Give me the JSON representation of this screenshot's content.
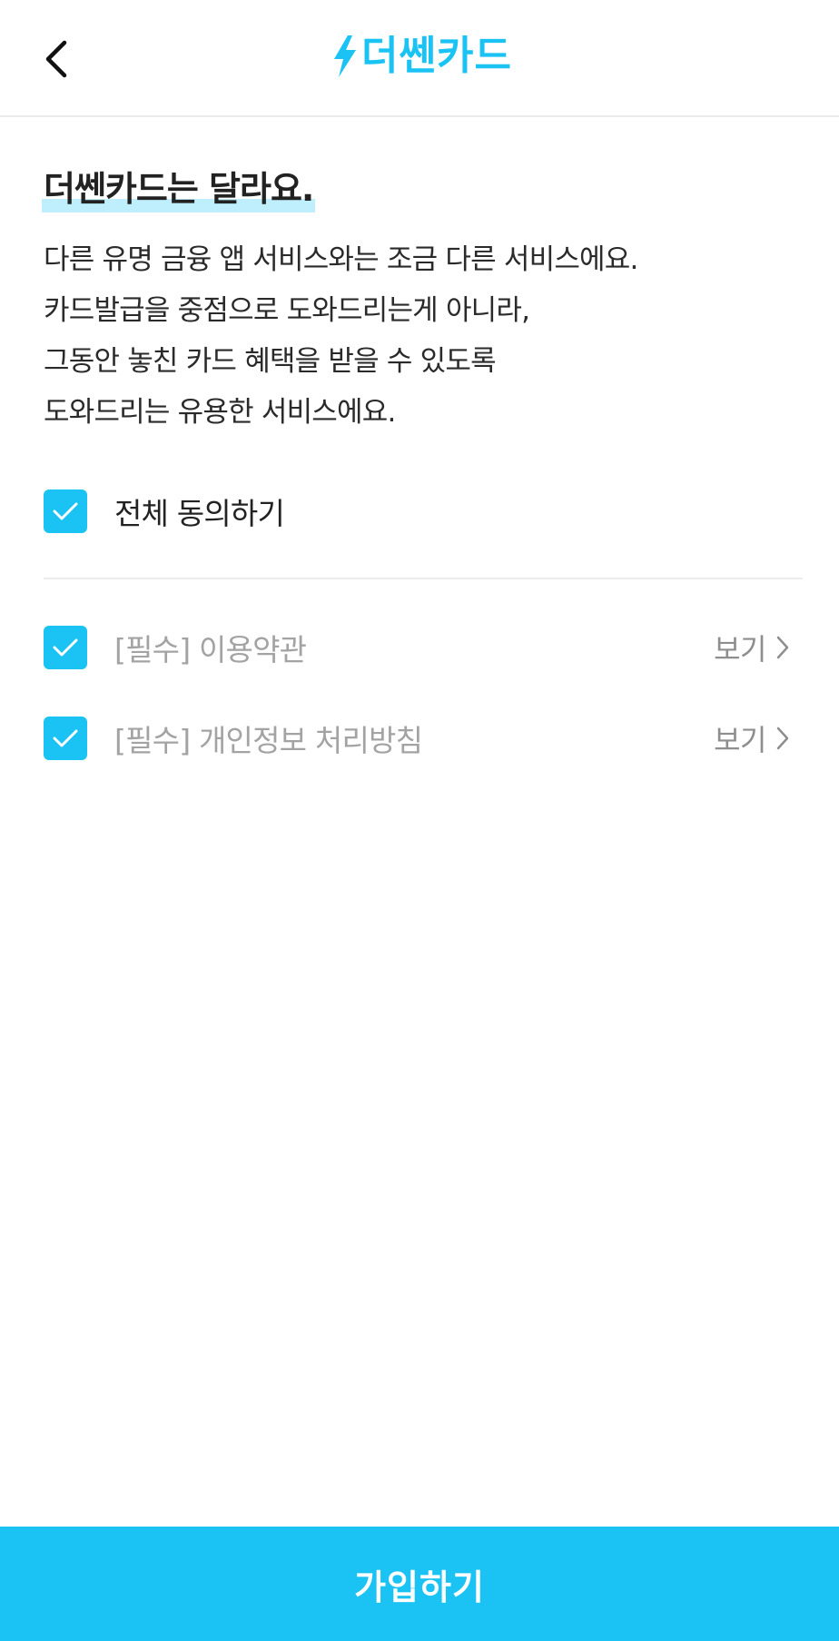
{
  "header": {
    "back_icon": "chevron-left-icon",
    "logo_icon": "lightning-bolt-icon",
    "logo_text": "더쎈카드",
    "brand_color": "#1bc3f5"
  },
  "intro": {
    "headline": "더쎈카드는 달라요.",
    "description_lines": [
      "다른 유명 금융 앱 서비스와는 조금 다른 서비스에요.",
      "카드발급을 중점으로 도와드리는게 아니라,",
      "그동안 놓친 카드 혜택을 받을 수 있도록",
      "도와드리는 유용한 서비스에요."
    ]
  },
  "agreement": {
    "all_label": "전체 동의하기",
    "all_checked": true,
    "terms": [
      {
        "label": "[필수] 이용약관",
        "checked": true,
        "view_label": "보기"
      },
      {
        "label": "[필수] 개인정보 처리방침",
        "checked": true,
        "view_label": "보기"
      }
    ]
  },
  "footer": {
    "join_label": "가입하기"
  }
}
